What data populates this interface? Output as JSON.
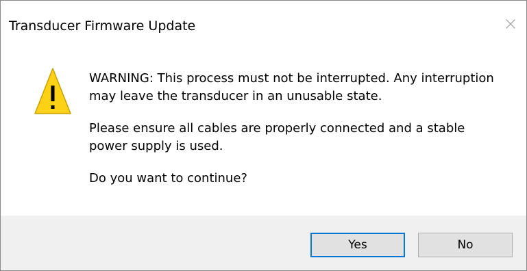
{
  "dialog": {
    "title": "Transducer Firmware Update",
    "icon": "warning-icon",
    "message": {
      "paragraph1": "WARNING: This process must not be interrupted. Any interruption may leave the transducer in an unusable state.",
      "paragraph2": "Please ensure all cables are properly connected and a stable power supply is used.",
      "paragraph3": "Do you want to continue?"
    },
    "buttons": {
      "yes_label": "Yes",
      "no_label": "No",
      "default": "Yes"
    }
  },
  "colors": {
    "warning_fill": "#FCD116",
    "warning_stroke": "#C8A000",
    "default_button_border": "#0078D7",
    "footer_background": "#F0F0F0"
  }
}
